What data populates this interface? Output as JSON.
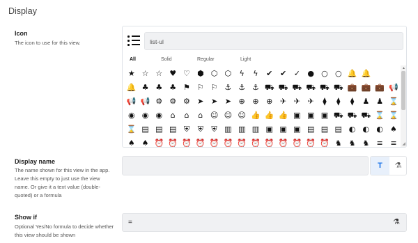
{
  "section": {
    "title": "Display"
  },
  "icon_field": {
    "label": "Icon",
    "description": "The icon to use for this view.",
    "current_value": "list-ul",
    "current_icon": "list-ul-icon",
    "filters": [
      "All",
      "Solid",
      "Regular",
      "Light"
    ],
    "active_filter": "All",
    "grid": [
      [
        "★",
        "☆",
        "☆",
        "♥",
        "♡",
        "⬢",
        "⬡",
        "⬡",
        "ϟ",
        "ϟ",
        "✔",
        "✔",
        "✓",
        "●",
        "○",
        "○",
        "🔔",
        "🔔"
      ],
      [
        "🔔",
        "♣",
        "♣",
        "♣",
        "⚑",
        "⚐",
        "⚐",
        "⚓",
        "⚓",
        "⚓",
        "⛟",
        "⛟",
        "⛟",
        "⛟",
        "⛟",
        "⛟",
        "💼",
        "💼",
        "💼",
        "📢"
      ],
      [
        "📢",
        "📢",
        "⚙",
        "⚙",
        "⚙",
        "➤",
        "➤",
        "➤",
        "⊕",
        "⊕",
        "⊕",
        "✈",
        "✈",
        "✈",
        "⧫",
        "⧫",
        "⧫",
        "♟",
        "♟",
        "⌛"
      ],
      [
        "◉",
        "◉",
        "◉",
        "⌂",
        "⌂",
        "⌂",
        "☺",
        "☺",
        "☺",
        "👍",
        "👍",
        "👍",
        "▣",
        "▣",
        "▣",
        "⛟",
        "⛟",
        "⛟",
        "⌛",
        "⌛"
      ],
      [
        "⌛",
        "▤",
        "▤",
        "▤",
        "⛨",
        "⛨",
        "⛨",
        "▥",
        "▥",
        "▥",
        "▣",
        "▣",
        "▣",
        "▤",
        "▤",
        "▤",
        "◐",
        "◐",
        "◐",
        "♠"
      ],
      [
        "♠",
        "♠",
        "⏰",
        "⏰",
        "⏰",
        "⏰",
        "⏰",
        "⏰",
        "⏰",
        "⏰",
        "⏰",
        "⏰",
        "⏰",
        "⏰",
        "⏰",
        "♞",
        "♞",
        "♞",
        "≡",
        "≡"
      ]
    ]
  },
  "display_name": {
    "label": "Display name",
    "description": "The name shown for this view in the app. Leave this empty to just use the view name. Or give it a text value (double-quoted) or a formula",
    "value": "",
    "mode_text_glyph": "T",
    "mode_formula_glyph": "⚗"
  },
  "show_if": {
    "label": "Show if",
    "description": "Optional Yes/No formula to decide whether this view should be shown",
    "value": "=",
    "formula_glyph": "⚗"
  }
}
